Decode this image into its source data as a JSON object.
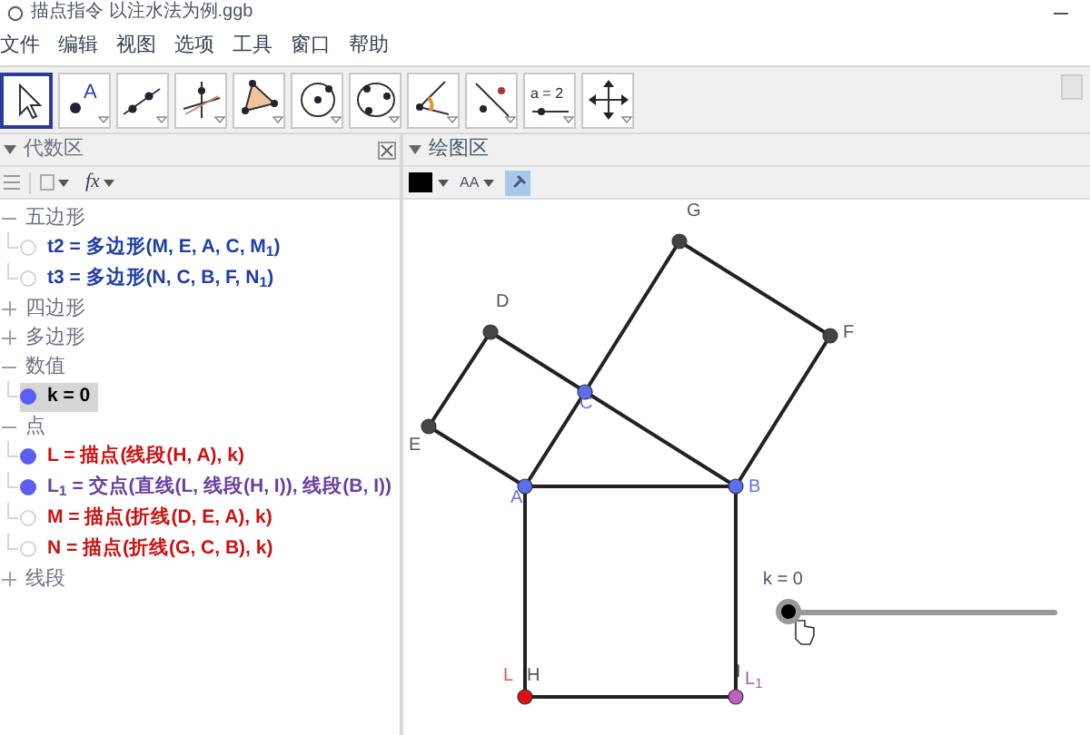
{
  "window": {
    "title": "描点指令 以注水法为例.ggb"
  },
  "menu": [
    "文件",
    "编辑",
    "视图",
    "选项",
    "工具",
    "窗口",
    "帮助"
  ],
  "toolbar": [
    {
      "kind": "move",
      "selected": true
    },
    {
      "kind": "point",
      "text": "A",
      "selected": false
    },
    {
      "kind": "line",
      "selected": false
    },
    {
      "kind": "perpendicular",
      "selected": false
    },
    {
      "kind": "polygon",
      "selected": false
    },
    {
      "kind": "circle",
      "selected": false
    },
    {
      "kind": "circle3",
      "selected": false
    },
    {
      "kind": "angle",
      "selected": false
    },
    {
      "kind": "reflect",
      "selected": false
    },
    {
      "kind": "slider",
      "text": "a = 2",
      "selected": false
    },
    {
      "kind": "pan",
      "selected": false
    }
  ],
  "algebra": {
    "title": "代数区",
    "fx": "fx",
    "groups": [
      {
        "label": "五边形",
        "expanded": true,
        "items": [
          {
            "text": "t2 = 多边形(M, E, A, C, M$_{1}$)",
            "visible": false,
            "selected": false,
            "color": "#1f3fa8"
          },
          {
            "text": "t3 = 多边形(N, C, B, F, N$_{1}$)",
            "visible": false,
            "selected": false,
            "color": "#1f3fa8"
          }
        ]
      },
      {
        "label": "四边形",
        "expanded": false
      },
      {
        "label": "多边形",
        "expanded": false
      },
      {
        "label": "数值",
        "expanded": true,
        "items": [
          {
            "text": "k = 0",
            "visible": true,
            "selected": true,
            "color": "#000000"
          }
        ]
      },
      {
        "label": "点",
        "expanded": true,
        "items": [
          {
            "text": "L = 描点(线段(H, A), k)",
            "visible": true,
            "selected": false,
            "color": "#cc1111"
          },
          {
            "text": "L$_{1}$ = 交点(直线(L, 线段(H, I)), 线段(B, I))",
            "visible": true,
            "selected": false,
            "color": "#6a3fa0"
          },
          {
            "text": "M = 描点(折线(D, E, A), k)",
            "visible": false,
            "selected": false,
            "color": "#cc1111"
          },
          {
            "text": "N = 描点(折线(G, C, B), k)",
            "visible": false,
            "selected": false,
            "color": "#cc1111"
          }
        ]
      },
      {
        "label": "线段",
        "expanded": false
      }
    ]
  },
  "graphics": {
    "title": "绘图区",
    "style_text": "AA",
    "labels": [
      {
        "text": "G",
        "color": "#555555"
      },
      {
        "text": "D",
        "color": "#555555"
      },
      {
        "text": "F",
        "color": "#555555"
      },
      {
        "text": "C",
        "color": "#6673e0"
      },
      {
        "text": "E",
        "color": "#555555"
      },
      {
        "text": "A",
        "color": "#6673e0"
      },
      {
        "text": "B",
        "color": "#6673e0"
      },
      {
        "text": "L",
        "color": "#e05050"
      },
      {
        "text": "H",
        "color": "#555555"
      },
      {
        "text": "I",
        "color": "#555555"
      },
      {
        "text": "L$_{1}$",
        "color": "#a060a0"
      }
    ],
    "points": [
      {
        "color": "#444444"
      },
      {
        "color": "#444444"
      },
      {
        "color": "#444444"
      },
      {
        "color": "#5b6ef0"
      },
      {
        "color": "#444444"
      },
      {
        "color": "#5b6ef0"
      },
      {
        "color": "#5b6ef0"
      },
      {
        "color": "#dd1111"
      },
      {
        "color": "#c060c0"
      }
    ],
    "slider": {
      "label": "k = 0",
      "level": 0
    }
  }
}
